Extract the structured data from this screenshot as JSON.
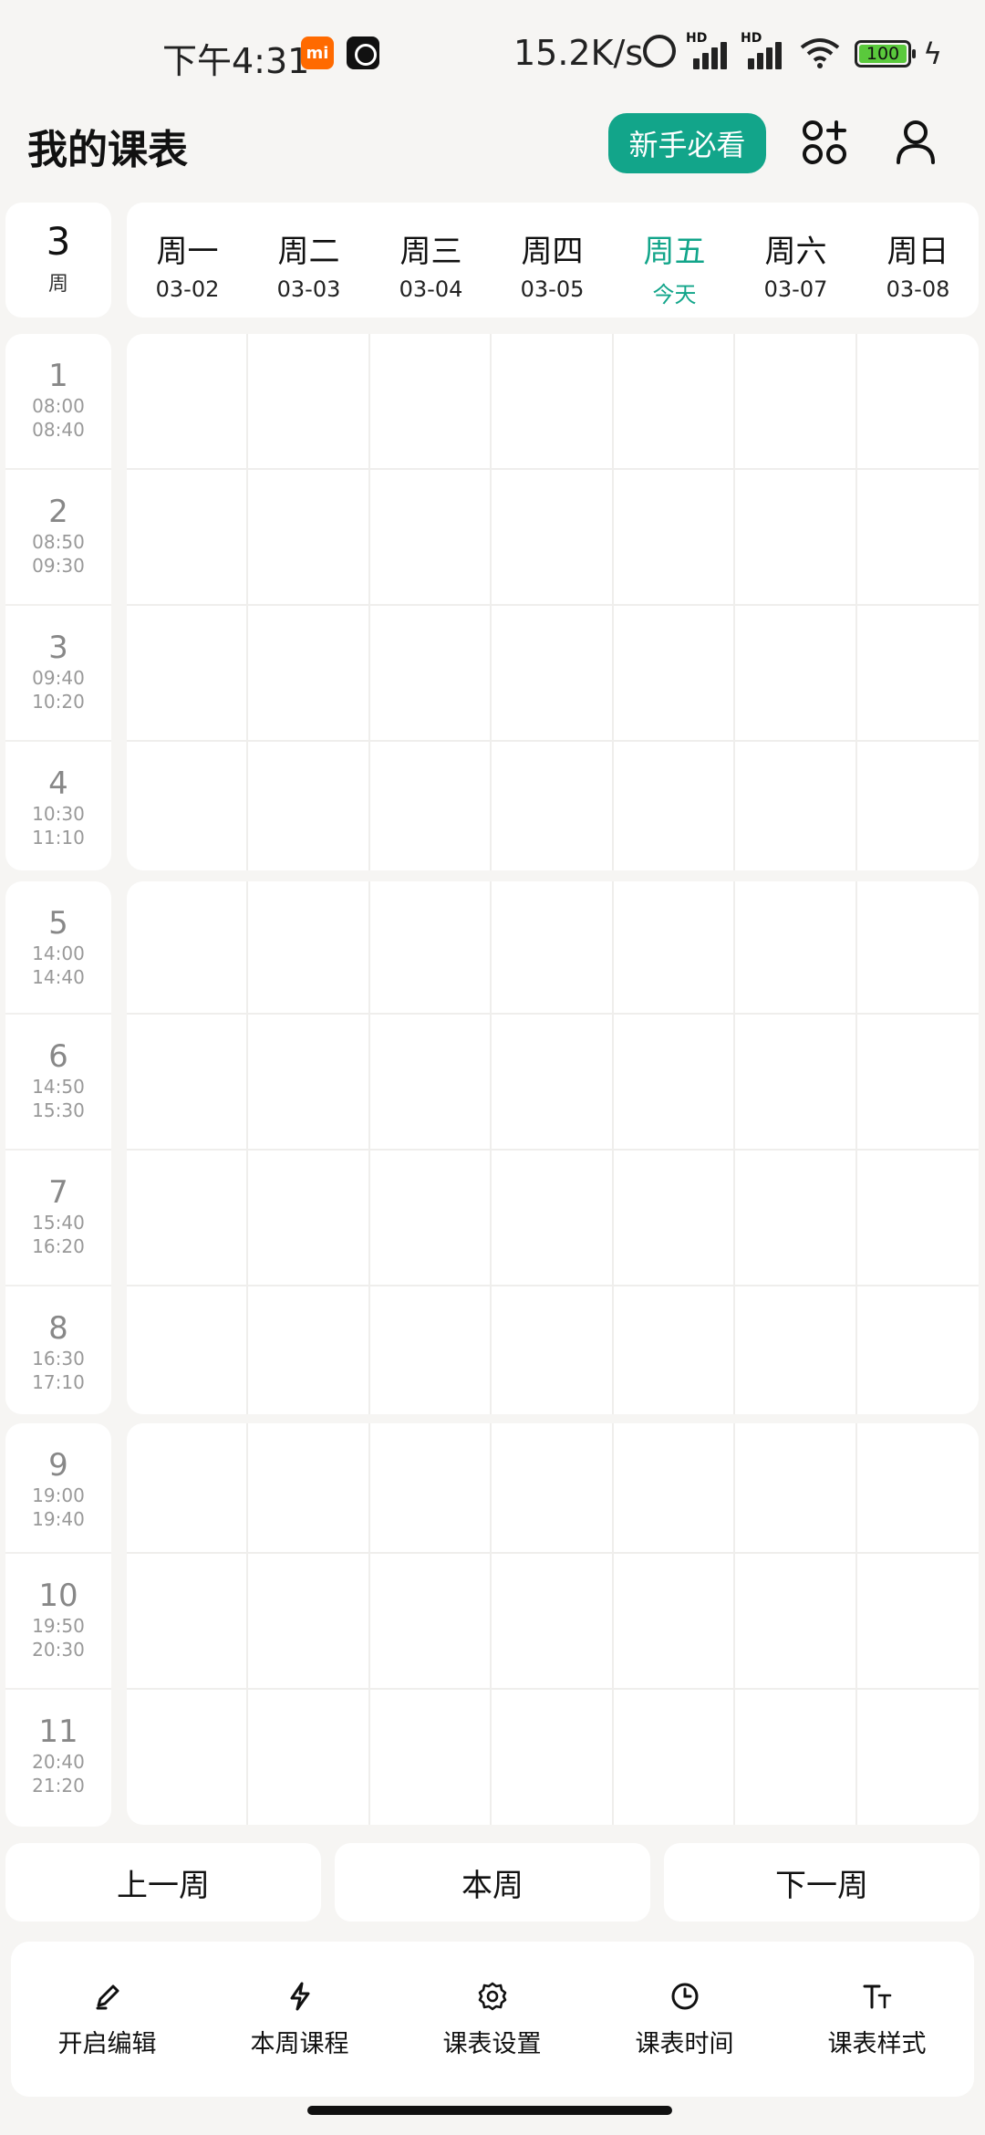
{
  "status_bar": {
    "time": "下午4:31",
    "mi_label": "mi",
    "net_speed": "15.2K/s",
    "signal_hd": "HD",
    "battery": "100",
    "battery_color": "#5ac93c"
  },
  "header": {
    "title": "我的课表",
    "guide_button": "新手必看",
    "accent": "#12a58a"
  },
  "week": {
    "number": "3",
    "unit": "周"
  },
  "days": [
    {
      "name": "周一",
      "date": "03-02"
    },
    {
      "name": "周二",
      "date": "03-03"
    },
    {
      "name": "周三",
      "date": "03-04"
    },
    {
      "name": "周四",
      "date": "03-05"
    },
    {
      "name": "周五",
      "date": "今天",
      "today": true
    },
    {
      "name": "周六",
      "date": "03-07"
    },
    {
      "name": "周日",
      "date": "03-08"
    }
  ],
  "periods": [
    {
      "num": "1",
      "start": "08:00",
      "end": "08:40"
    },
    {
      "num": "2",
      "start": "08:50",
      "end": "09:30"
    },
    {
      "num": "3",
      "start": "09:40",
      "end": "10:20"
    },
    {
      "num": "4",
      "start": "10:30",
      "end": "11:10"
    },
    {
      "num": "5",
      "start": "14:00",
      "end": "14:40"
    },
    {
      "num": "6",
      "start": "14:50",
      "end": "15:30"
    },
    {
      "num": "7",
      "start": "15:40",
      "end": "16:20"
    },
    {
      "num": "8",
      "start": "16:30",
      "end": "17:10"
    },
    {
      "num": "9",
      "start": "19:00",
      "end": "19:40"
    },
    {
      "num": "10",
      "start": "19:50",
      "end": "20:30"
    },
    {
      "num": "11",
      "start": "20:40",
      "end": "21:20"
    }
  ],
  "nav": {
    "prev": "上一周",
    "current": "本周",
    "next": "下一周"
  },
  "toolbar": [
    {
      "label": "开启编辑",
      "icon": "pencil-icon"
    },
    {
      "label": "本周课程",
      "icon": "lightning-icon"
    },
    {
      "label": "课表设置",
      "icon": "gear-icon"
    },
    {
      "label": "课表时间",
      "icon": "clock-icon"
    },
    {
      "label": "课表样式",
      "icon": "text-size-icon"
    }
  ]
}
